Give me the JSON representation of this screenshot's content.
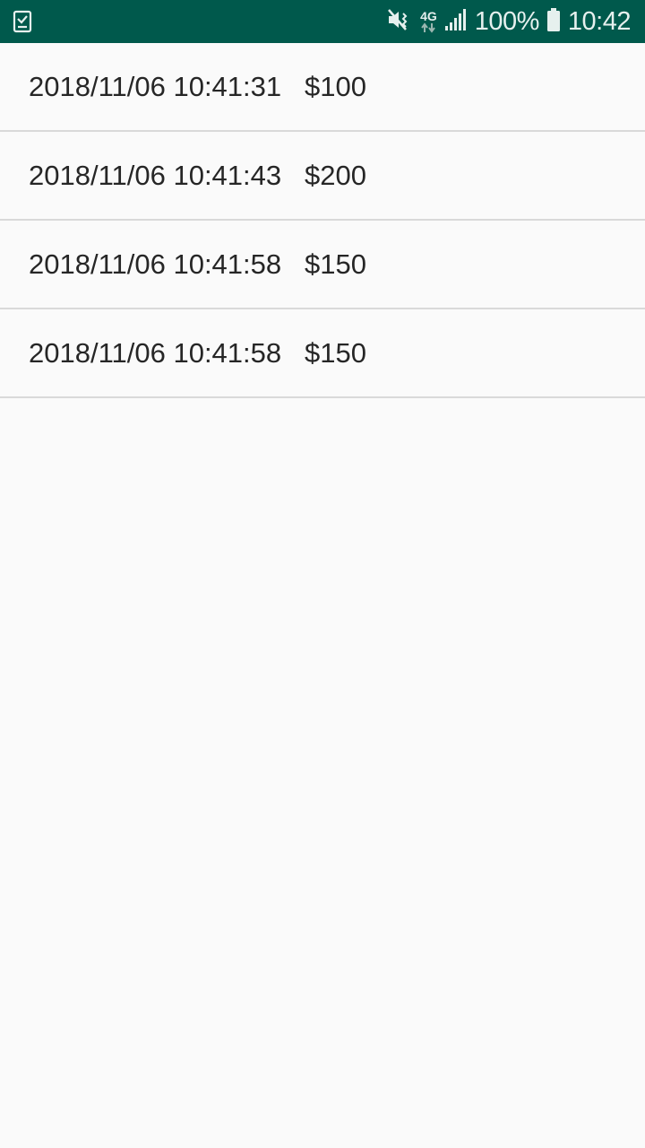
{
  "status_bar": {
    "background": "#00594c",
    "left_icon": "task-checklist-icon",
    "icons": [
      "vibrate-mute-icon",
      "network-4g-icon",
      "signal-bars-icon",
      "battery-icon"
    ],
    "network_label": "4G",
    "battery_percent": "100%",
    "battery_level": 1.0,
    "time": "10:42"
  },
  "list": {
    "items": [
      {
        "text": "2018/11/06 10:41:31   $100"
      },
      {
        "text": "2018/11/06 10:41:43   $200"
      },
      {
        "text": "2018/11/06 10:41:58   $150"
      },
      {
        "text": "2018/11/06 10:41:58   $150"
      }
    ]
  }
}
